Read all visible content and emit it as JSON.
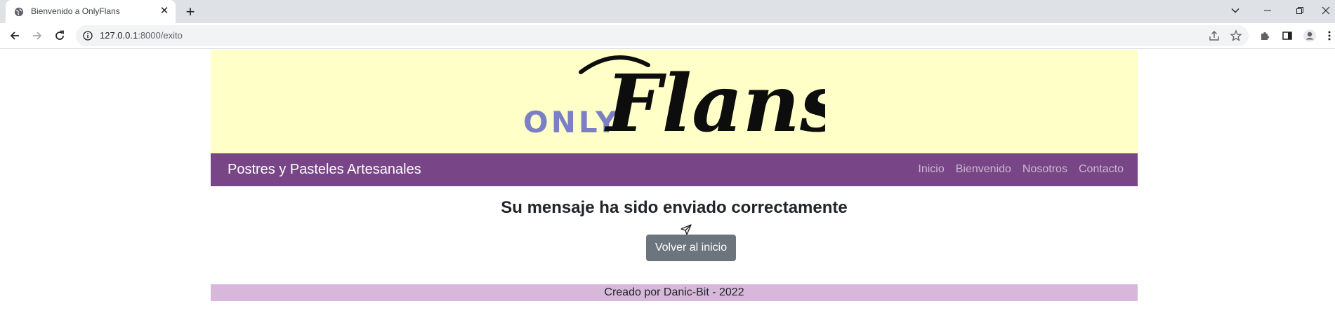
{
  "browser": {
    "tab_title": "Bienvenido a OnlyFlans",
    "url_host": "127.0.0.1",
    "url_rest": ":8000/exito"
  },
  "header": {
    "logo_only": "ONLY",
    "logo_flans": "Flans",
    "colors": {
      "banner": "#ffffc8",
      "logo_only": "#7b7fc4",
      "navbar": "#784586"
    }
  },
  "navbar": {
    "brand": "Postres y Pasteles Artesanales",
    "links": [
      "Inicio",
      "Bienvenido",
      "Nosotros",
      "Contacto"
    ]
  },
  "main": {
    "title": "Su mensaje ha sido enviado correctamente",
    "icon": "send-icon",
    "button_label": "Volver al inicio"
  },
  "footer": {
    "text": "Creado por Danic-Bit - 2022",
    "color": "#d7b8da"
  }
}
